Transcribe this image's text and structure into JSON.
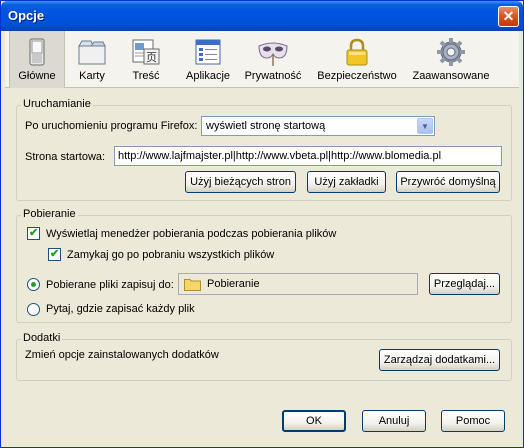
{
  "window": {
    "title": "Opcje",
    "close_symbol": "✕"
  },
  "toolbar": {
    "items": [
      {
        "label": "Główne",
        "icon": "switch-icon"
      },
      {
        "label": "Karty",
        "icon": "tabs-icon"
      },
      {
        "label": "Treść",
        "icon": "content-icon"
      },
      {
        "label": "Aplikacje",
        "icon": "applications-icon"
      },
      {
        "label": "Prywatność",
        "icon": "privacy-mask-icon"
      },
      {
        "label": "Bezpieczeństwo",
        "icon": "padlock-icon"
      },
      {
        "label": "Zaawansowane",
        "icon": "gear-icon"
      }
    ],
    "active_index": 0
  },
  "startup": {
    "group_title": "Uruchamianie",
    "when_start_label": "Po uruchomieniu programu Firefox:",
    "when_start_value": "wyświetl stronę startową",
    "home_label": "Strona startowa:",
    "home_value": "http://www.lajfmajster.pl|http://www.vbeta.pl|http://www.blomedia.pl",
    "btn_current": "Użyj bieżących stron",
    "btn_bookmark": "Użyj zakładki",
    "btn_restore": "Przywróć domyślną"
  },
  "downloads": {
    "group_title": "Pobieranie",
    "show_manager_label": "Wyświetlaj menedżer pobierania podczas pobierania plików",
    "show_manager_checked": true,
    "close_when_done_label": "Zamykaj go po pobraniu wszystkich plików",
    "close_when_done_checked": true,
    "save_to_label": "Pobierane pliki zapisuj do:",
    "save_to_selected": true,
    "folder_name": "Pobieranie",
    "folder_icon": "folder-icon",
    "btn_browse": "Przeglądaj...",
    "ask_label": "Pytaj, gdzie zapisać każdy plik",
    "ask_selected": false
  },
  "addons": {
    "group_title": "Dodatki",
    "description": "Zmień opcje zainstalowanych dodatków",
    "btn_manage": "Zarządzaj dodatkami..."
  },
  "footer": {
    "ok": "OK",
    "cancel": "Anuluj",
    "help": "Pomoc"
  },
  "colors": {
    "titlebar": "#0053e1",
    "face": "#ece9d8",
    "check": "#21a121"
  }
}
